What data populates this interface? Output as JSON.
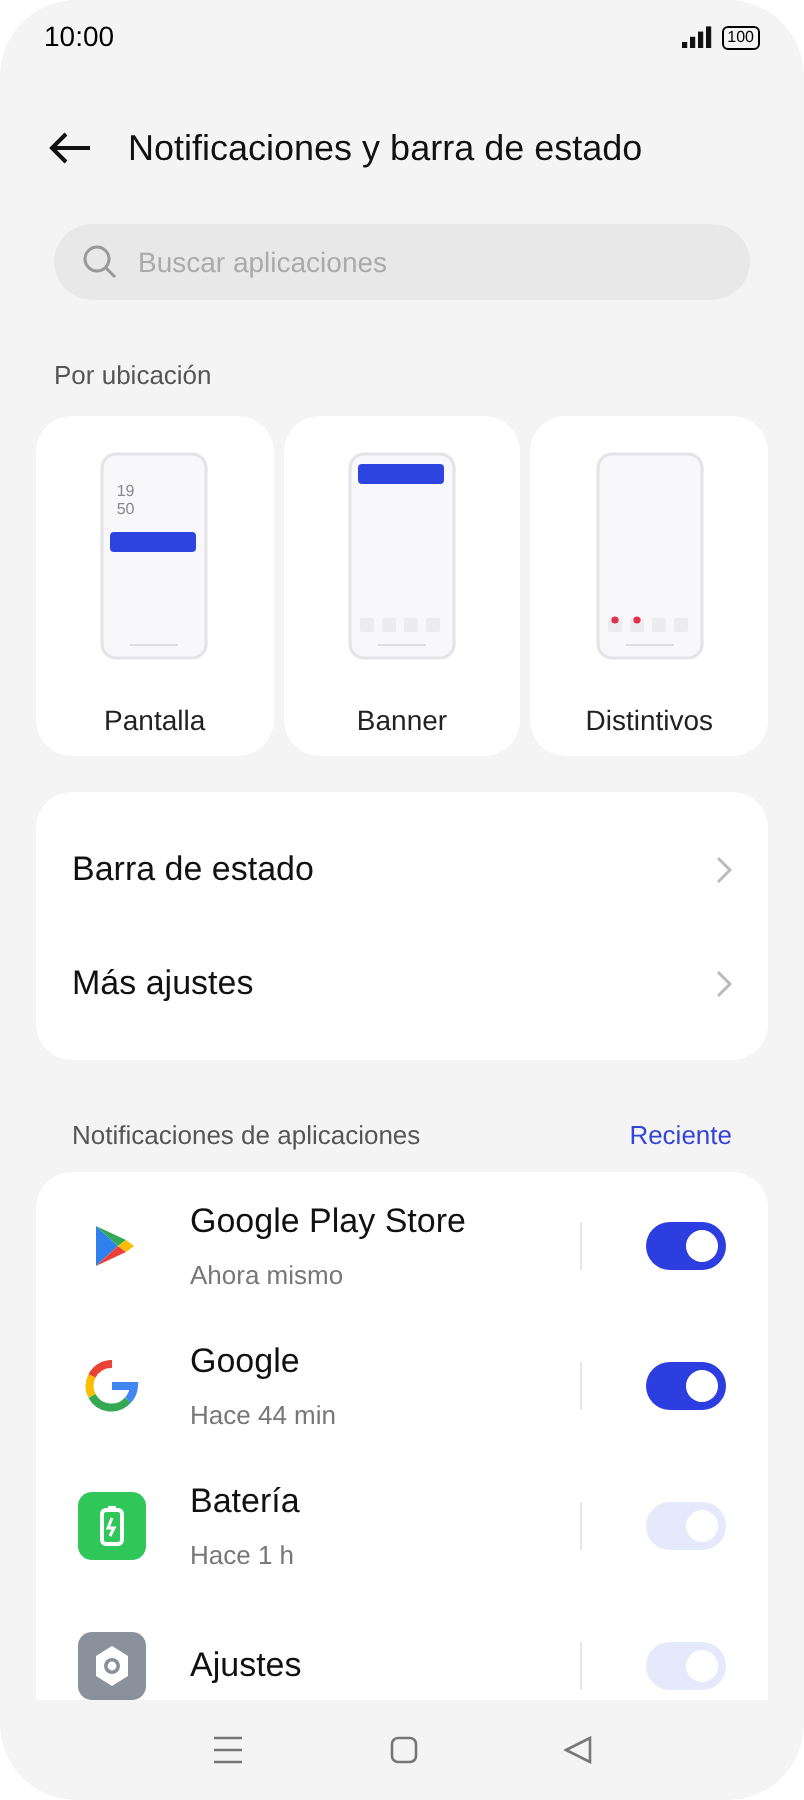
{
  "status_bar": {
    "time": "10:00",
    "battery": "100"
  },
  "header": {
    "title": "Notificaciones y barra de estado"
  },
  "search": {
    "placeholder": "Buscar aplicaciones"
  },
  "placement": {
    "heading": "Por ubicación",
    "options": [
      {
        "label": "Pantalla",
        "kind": "lock",
        "clock": [
          "19",
          "50"
        ]
      },
      {
        "label": "Banner",
        "kind": "banner"
      },
      {
        "label": "Distintivos",
        "kind": "badges"
      }
    ]
  },
  "menu": [
    {
      "label": "Barra de estado"
    },
    {
      "label": "Más ajustes"
    }
  ],
  "apps_section": {
    "heading": "Notificaciones de aplicaciones",
    "sort": "Reciente"
  },
  "apps": [
    {
      "name": "Google Play Store",
      "time": "Ahora mismo",
      "kind": "play",
      "on": true,
      "disabled": false
    },
    {
      "name": "Google",
      "time": "Hace 44 min",
      "kind": "google",
      "on": true,
      "disabled": false
    },
    {
      "name": "Batería",
      "time": "Hace 1 h",
      "kind": "battery",
      "on": true,
      "disabled": true
    },
    {
      "name": "Ajustes",
      "kind": "gear",
      "on": true,
      "disabled": true
    }
  ]
}
